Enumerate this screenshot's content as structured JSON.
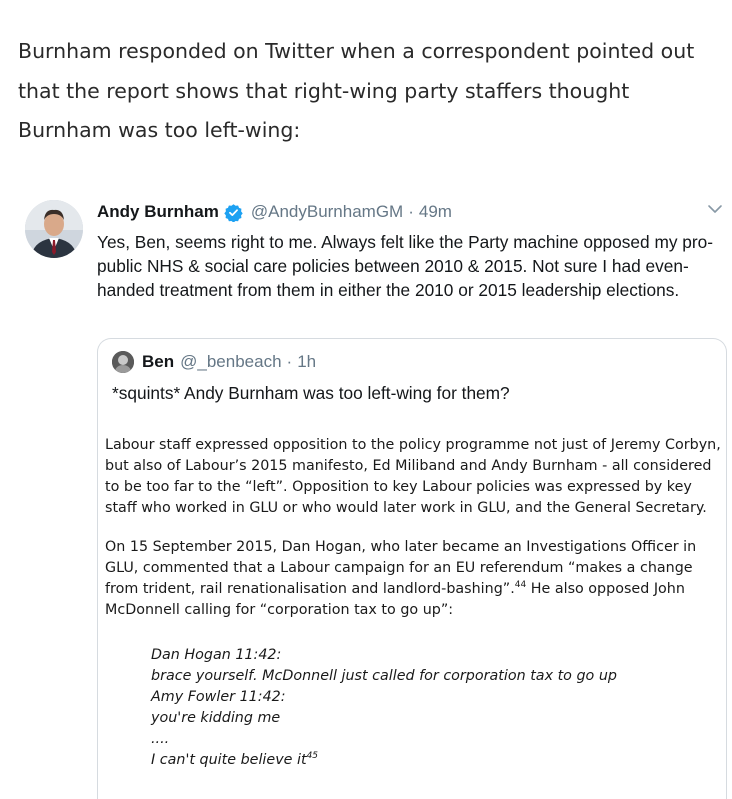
{
  "intro_text": "Burnham responded on Twitter when a correspondent pointed out that the report shows that right-wing party staffers thought Burnham was too left-wing:",
  "tweet": {
    "name": "Andy Burnham",
    "handle": "@AndyBurnhamGM",
    "separator": "·",
    "time": "49m",
    "text": "Yes, Ben, seems right to me. Always felt like the Party machine opposed my pro-public NHS & social care policies between 2010 & 2015. Not sure I had even-handed treatment from them in either the 2010 or 2015 leadership elections.",
    "icons": {
      "verified": "verified-badge-icon",
      "menu": "chevron-down-icon"
    },
    "colors": {
      "verified": "#1da1f2",
      "muted": "#657786"
    }
  },
  "quoted_tweet": {
    "name": "Ben",
    "handle": "@_benbeach",
    "separator": "·",
    "time": "1h",
    "text": "*squints* Andy Burnham was too left-wing for them?",
    "document": {
      "paragraph_1": "Labour staff expressed opposition to the policy programme not just of Jeremy Corbyn, but also of Labour’s 2015 manifesto, Ed Miliband and Andy Burnham - all considered to be too far to the “left”. Opposition to key Labour policies was expressed by key staff who worked in GLU or who would later work in GLU, and the General Secretary.",
      "paragraph_2_a": "On 15 September 2015, Dan Hogan, who later became an Investigations Officer in GLU, commented that a Labour campaign for an EU referendum “makes a change from trident, rail renationalisation and landlord-bashing”.",
      "paragraph_2_sup": "44",
      "paragraph_2_b": " He also opposed John McDonnell calling for “corporation tax to go up”:",
      "chat_lines": [
        "Dan Hogan 11:42:",
        "brace yourself. McDonnell just called for corporation tax to go up",
        "Amy Fowler 11:42:",
        "you're kidding me",
        "....",
        "I can't quite believe it"
      ],
      "last_sup": "45"
    }
  }
}
